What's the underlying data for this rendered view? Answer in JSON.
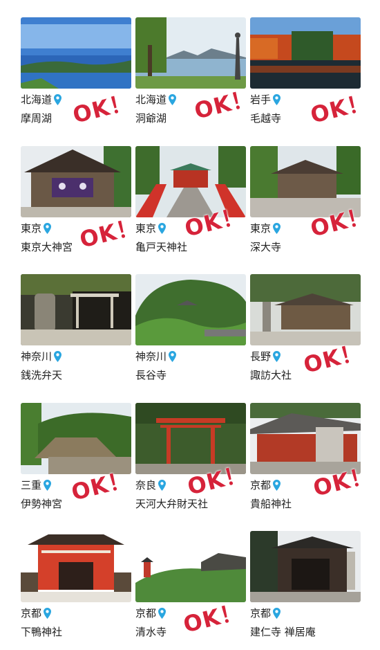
{
  "colors": {
    "accent_red": "#d6233a",
    "pin_blue": "#2aa6e0",
    "text": "#222222"
  },
  "ok_text": "OK！",
  "spots": [
    {
      "region": "北海道",
      "name": "摩周湖",
      "ok": true,
      "scene": "lake-blue"
    },
    {
      "region": "北海道",
      "name": "洞爺湖",
      "ok": true,
      "scene": "lake-statue"
    },
    {
      "region": "岩手",
      "name": "毛越寺",
      "ok": true,
      "scene": "autumn-pond"
    },
    {
      "region": "東京",
      "name": "東京大神宮",
      "ok": true,
      "scene": "shrine-dark"
    },
    {
      "region": "東京",
      "name": "亀戸天神社",
      "ok": true,
      "scene": "red-bridge"
    },
    {
      "region": "東京",
      "name": "深大寺",
      "ok": true,
      "scene": "temple-tree"
    },
    {
      "region": "神奈川",
      "name": "銭洗弁天",
      "ok": false,
      "scene": "cave-torii"
    },
    {
      "region": "神奈川",
      "name": "長谷寺",
      "ok": false,
      "scene": "green-hill"
    },
    {
      "region": "長野",
      "name": "諏訪大社",
      "ok": true,
      "scene": "wood-shrine"
    },
    {
      "region": "三重",
      "name": "伊勢神宮",
      "ok": true,
      "scene": "ise-roof"
    },
    {
      "region": "奈良",
      "name": "天河大弁財天社",
      "ok": true,
      "scene": "red-torii"
    },
    {
      "region": "京都",
      "name": "貴船神社",
      "ok": true,
      "scene": "kibune"
    },
    {
      "region": "京都",
      "name": "下鴨神社",
      "ok": false,
      "scene": "red-gate"
    },
    {
      "region": "京都",
      "name": "清水寺",
      "ok": true,
      "scene": "kiyomizu"
    },
    {
      "region": "京都",
      "name": "建仁寺 禅居庵",
      "ok": false,
      "scene": "dark-gate"
    }
  ]
}
